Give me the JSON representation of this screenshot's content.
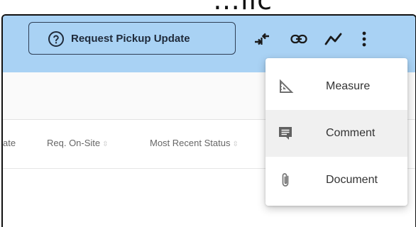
{
  "page_title_fragment": "…lic",
  "toolbar": {
    "request_pickup_label": "Request Pickup Update",
    "icons": [
      "help-circle-icon",
      "merge-arrows-icon",
      "link-icon",
      "trend-line-icon",
      "more-vert-icon"
    ]
  },
  "table": {
    "columns": [
      {
        "label": "ate",
        "sortable": true
      },
      {
        "label": "Req. On-Site",
        "sortable": true
      },
      {
        "label": "Most Recent Status",
        "sortable": true
      }
    ]
  },
  "menu": {
    "items": [
      {
        "label": "Measure",
        "icon": "ruler-triangle-icon"
      },
      {
        "label": "Comment",
        "icon": "comment-icon"
      },
      {
        "label": "Document",
        "icon": "paperclip-icon"
      }
    ]
  },
  "colors": {
    "appbar": "#a9d2f4",
    "menu_hover": "#f0f0f0"
  }
}
